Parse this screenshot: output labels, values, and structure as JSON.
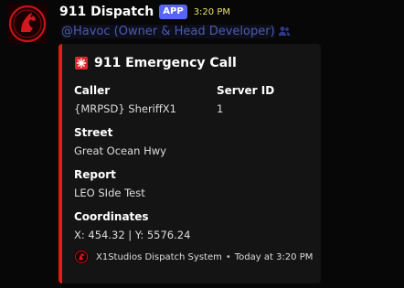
{
  "message": {
    "author": "911 Dispatch",
    "app_tag": "APP",
    "timestamp": "3:20 PM",
    "mention": "@Havoc (Owner & Head Developer)",
    "avatar_icon": "red-horse-logo-icon"
  },
  "embed": {
    "accent_color": "#e51b1b",
    "title": "911 Emergency Call",
    "title_icon": "rotating-light-icon",
    "fields": {
      "caller": {
        "name": "Caller",
        "value": "{MRPSD} SheriffX1"
      },
      "server_id": {
        "name": "Server ID",
        "value": "1"
      },
      "street": {
        "name": "Street",
        "value": "Great Ocean Hwy"
      },
      "report": {
        "name": "Report",
        "value": "LEO SIde Test"
      },
      "coordinates": {
        "name": "Coordinates",
        "value": "X: 454.32 | Y: 5576.24"
      }
    },
    "footer": {
      "text": "X1Studios Dispatch System",
      "separator": "•",
      "time": "Today at 3:20 PM"
    }
  }
}
